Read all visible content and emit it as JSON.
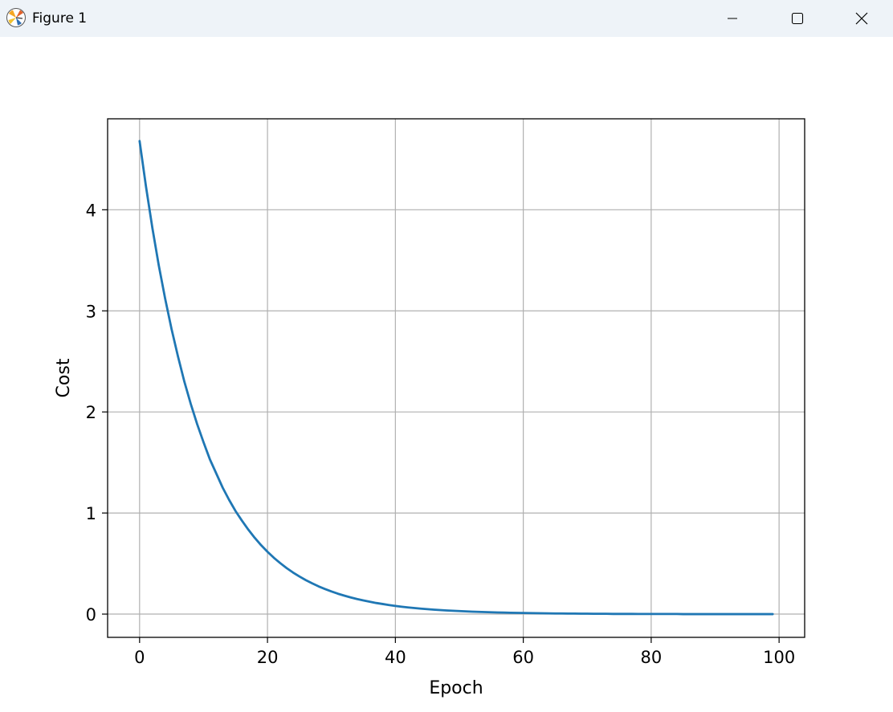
{
  "window": {
    "title": "Figure 1",
    "icon": "matplotlib-icon",
    "controls": {
      "minimize": "minimize-icon",
      "maximize": "maximize-icon",
      "close": "close-icon"
    }
  },
  "chart_data": {
    "type": "line",
    "title": "",
    "xlabel": "Epoch",
    "ylabel": "Cost",
    "xlim": [
      -5,
      104
    ],
    "ylim": [
      -0.23,
      4.9
    ],
    "xticks": [
      0,
      20,
      40,
      60,
      80,
      100
    ],
    "yticks": [
      0,
      1,
      2,
      3,
      4
    ],
    "grid": true,
    "line_color": "#1f77b4",
    "series": [
      {
        "x_start": 0,
        "x_end": 99,
        "values": [
          4.68,
          4.23,
          3.82,
          3.45,
          3.12,
          2.82,
          2.55,
          2.3,
          2.08,
          1.88,
          1.7,
          1.53,
          1.39,
          1.25,
          1.13,
          1.02,
          0.925,
          0.836,
          0.755,
          0.682,
          0.617,
          0.557,
          0.504,
          0.455,
          0.411,
          0.372,
          0.336,
          0.304,
          0.274,
          0.248,
          0.224,
          0.202,
          0.183,
          0.165,
          0.149,
          0.135,
          0.122,
          0.11,
          0.1,
          0.09,
          0.081,
          0.073,
          0.066,
          0.06,
          0.054,
          0.049,
          0.044,
          0.04,
          0.036,
          0.033,
          0.03,
          0.027,
          0.024,
          0.022,
          0.02,
          0.018,
          0.016,
          0.015,
          0.013,
          0.012,
          0.011,
          0.01,
          0.009,
          0.008,
          0.007,
          0.006,
          0.006,
          0.005,
          0.005,
          0.004,
          0.004,
          0.003,
          0.003,
          0.003,
          0.002,
          0.002,
          0.002,
          0.002,
          0.001,
          0.001,
          0.001,
          0.001,
          0.001,
          0.001,
          0.001,
          0.0,
          0.0,
          0.0,
          0.0,
          0.0,
          0.0,
          0.0,
          0.0,
          0.0,
          0.0,
          0.0,
          0.0,
          0.0,
          0.0,
          0.0
        ]
      }
    ]
  }
}
